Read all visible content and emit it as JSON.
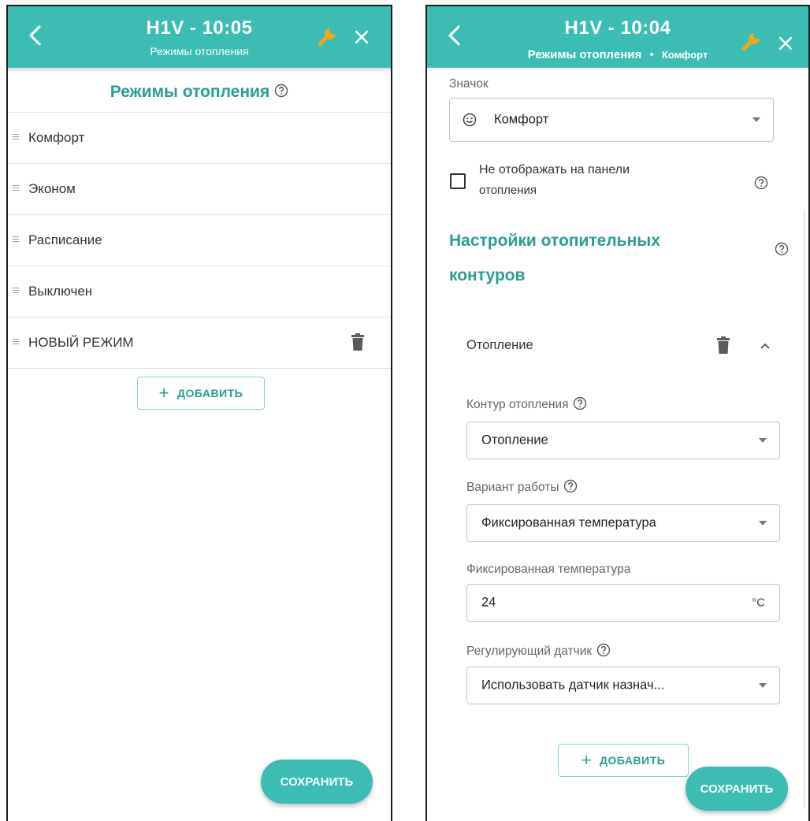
{
  "left": {
    "header": {
      "title": "H1V - 10:05",
      "subtitle": "Режимы отопления"
    },
    "section_title": "Режимы отопления",
    "modes": [
      "Комфорт",
      "Эконом",
      "Расписание",
      "Выключен",
      "НОВЫЙ РЕЖИМ"
    ],
    "add_label": "ДОБАВИТЬ",
    "save_label": "СОХРАНИТЬ"
  },
  "right": {
    "header": {
      "title": "H1V - 10:04",
      "breadcrumb_parent": "Режимы отопления",
      "breadcrumb_sep": "•",
      "breadcrumb_current": "Комфорт"
    },
    "icon_field": {
      "label": "Значок",
      "value": "Комфорт",
      "icon": "smiley-icon"
    },
    "hide_checkbox": {
      "label_line1": "Не отображать на панели",
      "label_line2": "отопления",
      "checked": false
    },
    "circuits_title_line1": "Настройки отопительных",
    "circuits_title_line2": "контуров",
    "circuit": {
      "name": "Отопление",
      "contour_label": "Контур отопления",
      "contour_value": "Отопление",
      "mode_label": "Вариант работы",
      "mode_value": "Фиксированная температура",
      "temp_label": "Фиксированная температура",
      "temp_value": "24",
      "temp_unit": "°C",
      "sensor_label": "Регулирующий датчик",
      "sensor_value": "Использовать датчик назнач..."
    },
    "add_label": "ДОБАВИТЬ",
    "save_label": "СОХРАНИТЬ"
  },
  "colors": {
    "accent": "#3bbcb5",
    "accent_text": "#2a9d95"
  }
}
